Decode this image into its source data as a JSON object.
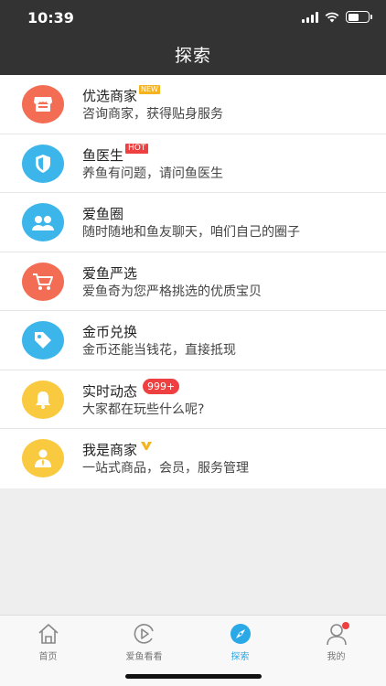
{
  "status": {
    "time": "10:39"
  },
  "header": {
    "title": "探索"
  },
  "colors": {
    "nav_bg": "#333333",
    "active_tab": "#2ba9e6",
    "badge_red": "#ee4040",
    "badge_new": "#f6b320"
  },
  "items": [
    {
      "name": "优选商家",
      "desc": "咨询商家，获得贴身服务",
      "badge": "NEW",
      "icon": "shop-icon",
      "color": "#f36d54"
    },
    {
      "name": "鱼医生",
      "desc": "养鱼有问题，请问鱼医生",
      "badge": "HOT",
      "icon": "shield-icon",
      "color": "#3cb6ea"
    },
    {
      "name": "爱鱼圈",
      "desc": "随时随地和鱼友聊天，咱们自己的圈子",
      "icon": "people-icon",
      "color": "#3cb6ea"
    },
    {
      "name": "爱鱼严选",
      "desc": "爱鱼奇为您严格挑选的优质宝贝",
      "icon": "cart-icon",
      "color": "#f36d54"
    },
    {
      "name": "金币兑换",
      "desc": "金币还能当钱花，直接抵现",
      "icon": "tag-icon",
      "color": "#3cb6ea"
    },
    {
      "name": "实时动态",
      "desc": "大家都在玩些什么呢?",
      "badge": "999+",
      "icon": "bell-icon",
      "color": "#f9c93f"
    },
    {
      "name": "我是商家",
      "desc": "一站式商品，会员，服务管理",
      "badge_icon": "verified-v-icon",
      "icon": "merchant-icon",
      "color": "#f9c93f"
    }
  ],
  "tabs": [
    {
      "label": "首页",
      "icon": "home-icon"
    },
    {
      "label": "爱鱼看看",
      "icon": "video-icon"
    },
    {
      "label": "探索",
      "icon": "compass-icon",
      "active": true
    },
    {
      "label": "我的",
      "icon": "user-icon"
    }
  ]
}
